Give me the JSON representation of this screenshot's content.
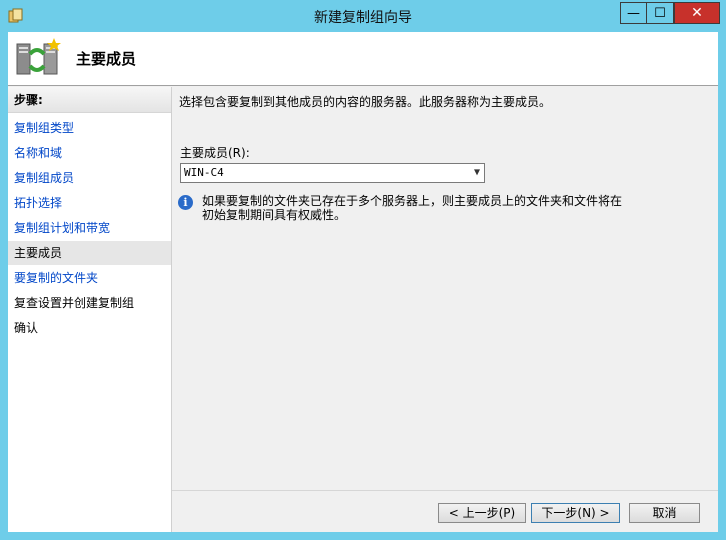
{
  "window": {
    "title": "新建复制组向导",
    "controls": {
      "minimize": "—",
      "maximize": "☐",
      "close": "✕"
    }
  },
  "header": {
    "title": "主要成员"
  },
  "steps": {
    "heading": "步骤:",
    "items": [
      {
        "label": "复制组类型",
        "state": "link"
      },
      {
        "label": "名称和域",
        "state": "link"
      },
      {
        "label": "复制组成员",
        "state": "link"
      },
      {
        "label": "拓扑选择",
        "state": "link"
      },
      {
        "label": "复制组计划和带宽",
        "state": "link"
      },
      {
        "label": "主要成员",
        "state": "current"
      },
      {
        "label": "要复制的文件夹",
        "state": "link"
      },
      {
        "label": "复查设置并创建复制组",
        "state": "disabled"
      },
      {
        "label": "确认",
        "state": "disabled"
      }
    ]
  },
  "main": {
    "description": "选择包含要复制到其他成员的内容的服务器。此服务器称为主要成员。",
    "primary_member_label": "主要成员(R):",
    "primary_member_value": "WIN-C4",
    "info_text": "如果要复制的文件夹已存在于多个服务器上，则主要成员上的文件夹和文件将在初始复制期间具有权威性。"
  },
  "footer": {
    "prev_label": "< 上一步(P)",
    "next_label": "下一步(N) >",
    "cancel_label": "取消"
  },
  "icons": {
    "app": "replication-wizard-icon",
    "header": "replication-group-icon",
    "info": "info-icon",
    "dropdown": "chevron-down-icon"
  }
}
